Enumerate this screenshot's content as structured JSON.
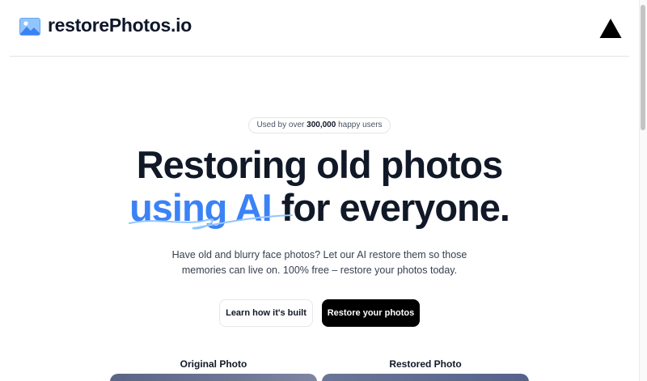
{
  "header": {
    "brand": "restorePhotos.io",
    "logo_icon": "photo-icon",
    "vercel_icon": "vercel-triangle-icon"
  },
  "hero": {
    "badge_prefix": "Used by over ",
    "badge_count": "300,000",
    "badge_suffix": " happy users",
    "headline_line1": "Restoring old photos",
    "headline_accent": "using AI",
    "headline_rest": " for everyone.",
    "subtitle": "Have old and blurry face photos? Let our AI restore them so those memories can live on. 100% free – restore your photos today.",
    "secondary_button": "Learn how it's built",
    "primary_button": "Restore your photos"
  },
  "comparison": {
    "original_label": "Original Photo",
    "restored_label": "Restored Photo"
  },
  "colors": {
    "accent": "#3b82f6",
    "primary_button_bg": "#000000",
    "text": "#111827"
  }
}
